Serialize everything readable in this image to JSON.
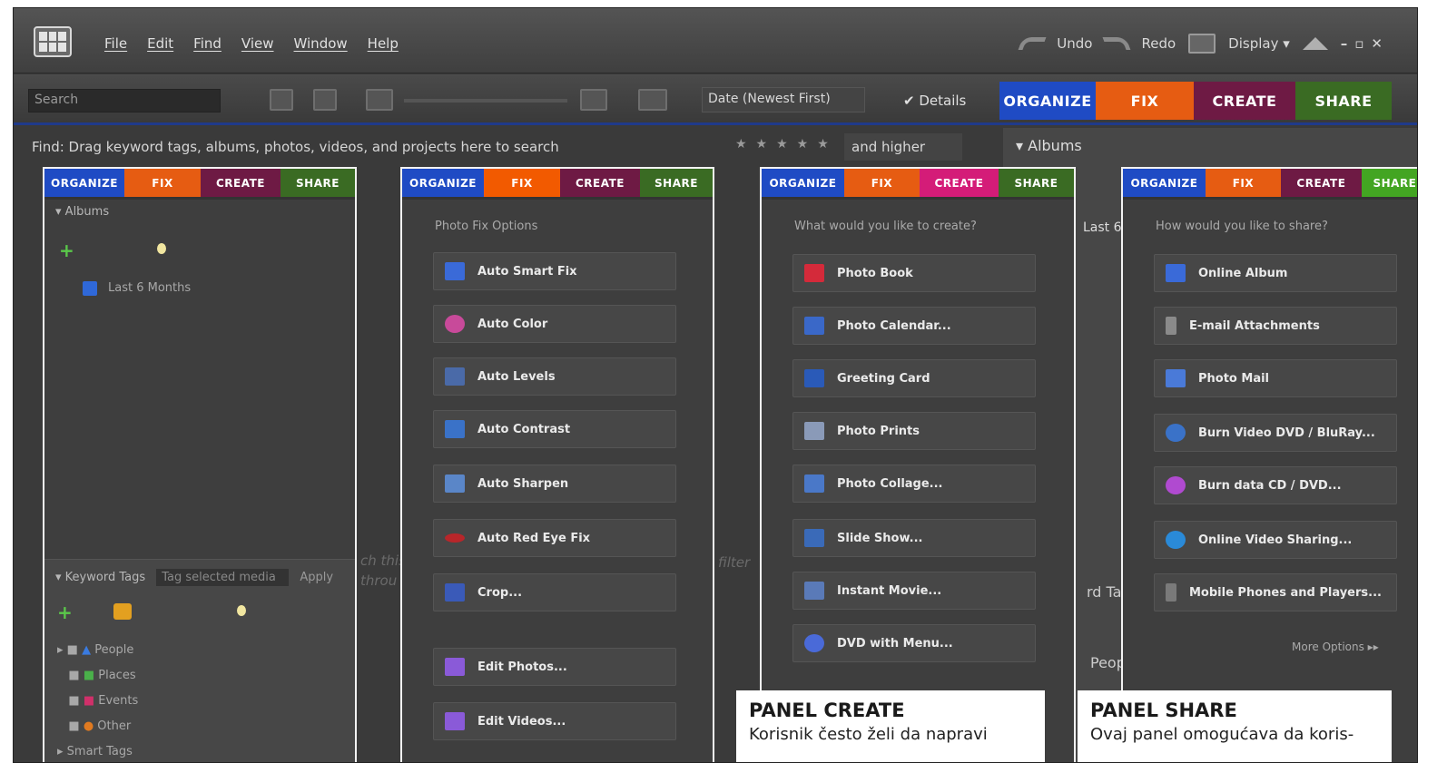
{
  "menubar": {
    "menus": [
      "File",
      "Edit",
      "Find",
      "View",
      "Window",
      "Help"
    ],
    "undo": "Undo",
    "redo": "Redo",
    "display": "Display ▾"
  },
  "toolbar": {
    "search_placeholder": "Search",
    "sort": "Date (Newest First)",
    "details": "Details"
  },
  "tabs": {
    "organize": "ORGANIZE",
    "fix": "FIX",
    "create": "CREATE",
    "share": "SHARE"
  },
  "findbar": {
    "text": "Find: Drag keyword tags, albums, photos, videos, and projects here to search",
    "higher": "and higher"
  },
  "side": {
    "albums": "Albums",
    "last6": "Last 6",
    "keyword_frag": "rd Ta",
    "peop": "Peop"
  },
  "organize_panel": {
    "albums": "Albums",
    "album_item": "Last 6 Months",
    "keyword_tags": "Keyword Tags",
    "tag_placeholder": "Tag selected media",
    "apply": "Apply",
    "tags": [
      "People",
      "Places",
      "Events",
      "Other"
    ],
    "smart_tags": "Smart Tags"
  },
  "fix_panel": {
    "title": "Photo Fix Options",
    "items": [
      "Auto Smart Fix",
      "Auto Color",
      "Auto Levels",
      "Auto Contrast",
      "Auto Sharpen",
      "Auto Red Eye Fix",
      "Crop...",
      "Edit Photos...",
      "Edit Videos..."
    ]
  },
  "create_panel": {
    "title": "What would you like to create?",
    "items": [
      "Photo Book",
      "Photo Calendar...",
      "Greeting Card",
      "Photo Prints",
      "Photo Collage...",
      "Slide Show...",
      "Instant Movie...",
      "DVD with Menu..."
    ]
  },
  "share_panel": {
    "title": "How would you like to share?",
    "items": [
      "Online Album",
      "E-mail Attachments",
      "Photo Mail",
      "Burn Video DVD / BluRay...",
      "Burn data CD / DVD...",
      "Online Video Sharing...",
      "Mobile Phones and Players..."
    ],
    "more": "More Options ▸▸"
  },
  "ghost": {
    "a": "ch this",
    "b": "throu",
    "c": "filter"
  },
  "captions": {
    "create": {
      "title": "PANEL CREATE",
      "text": "Korisnik često želi da napravi"
    },
    "share": {
      "title": "PANEL SHARE",
      "text": "Ovaj panel omogućava da koris-"
    }
  },
  "colors": {
    "organize": "#1f4bc4",
    "fix": "#e65c12",
    "create": "#6e1a44",
    "share": "#3a6b23",
    "create_active": "#d41c78",
    "share_active": "#43a522"
  }
}
